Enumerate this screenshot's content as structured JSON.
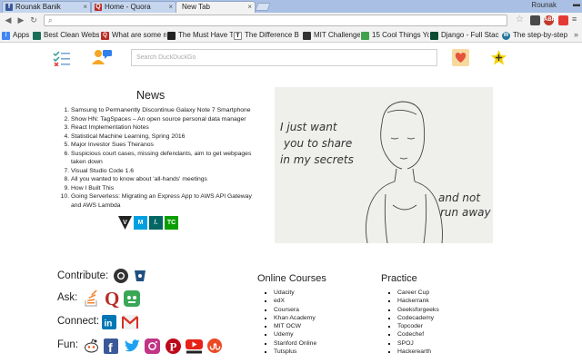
{
  "browser": {
    "tabs": [
      {
        "title": "Rounak Banik",
        "favicon": "facebook-icon"
      },
      {
        "title": "Home - Quora",
        "favicon": "quora-icon"
      },
      {
        "title": "New Tab",
        "favicon": "",
        "active": true
      }
    ],
    "profile_name": "Rounak",
    "address": "",
    "extension_badge": "ABP",
    "bookmarks": [
      {
        "label": "Apps",
        "icon": "apps-icon"
      },
      {
        "label": "Best Clean Websi",
        "icon": "bookmark-icon"
      },
      {
        "label": "What are some m",
        "icon": "quora-icon"
      },
      {
        "label": "The Must Have T",
        "icon": "bookmark-icon"
      },
      {
        "label": "The Difference B",
        "icon": "nyt-icon"
      },
      {
        "label": "MIT Challenge",
        "icon": "bookmark-icon"
      },
      {
        "label": "15 Cool Things Yo",
        "icon": "bookmark-icon"
      },
      {
        "label": "Django - Full Stac",
        "icon": "bookmark-icon"
      },
      {
        "label": "The step-by-step",
        "icon": "wordpress-icon"
      }
    ]
  },
  "header": {
    "search_placeholder": "Search DuckDuckGo"
  },
  "news": {
    "title": "News",
    "items": [
      "Samsung to Permanently Discontinue Galaxy Note 7 Smartphone",
      "Show HN: TagSpaces – An open source personal data manager",
      "React Implementation Notes",
      "Statistical Machine Learning, Spring 2016",
      "Major Investor Sues Theranos",
      "Suspicious court cases, missing defendants, aim to get webpages taken down",
      "Visual Studio Code 1.6",
      "All you wanted to know about 'all-hands' meetings",
      "How I Built This",
      "Going Serverless: Migrating an Express App to AWS API Gateway and AWS Lambda"
    ],
    "sources": [
      {
        "label": "V",
        "color": "#222222"
      },
      {
        "label": "M",
        "color": "#00a0e0"
      },
      {
        "label": "/.",
        "color": "#026664"
      },
      {
        "label": "TC",
        "color": "#0a9e01"
      }
    ]
  },
  "picture": {
    "handwriting_line1": "I just want",
    "handwriting_line2": "you to share",
    "handwriting_line3": "in my secrets",
    "handwriting_line4": "and not",
    "handwriting_line5": "run away"
  },
  "links": {
    "contribute_label": "Contribute:",
    "ask_label": "Ask:",
    "connect_label": "Connect:",
    "fun_label": "Fun:"
  },
  "courses": {
    "title": "Online Courses",
    "items": [
      "Udacity",
      "edX",
      "Coursera",
      "Khan Academy",
      "MIT OCW",
      "Udemy",
      "Stanford Online",
      "Tutsplus"
    ]
  },
  "practice": {
    "title": "Practice",
    "items": [
      "Career Cup",
      "Hackerrank",
      "Geeksforgeeks",
      "Codecademy",
      "Topcoder",
      "Codechef",
      "SPOJ",
      "Hackerearth"
    ]
  },
  "colors": {
    "tabstrip": "#a9c0e4",
    "toolbar": "#f2f2f2",
    "heart": "#f08a2a",
    "star_badge": "#f5d000",
    "quora": "#b92b27",
    "youtube": "#e62117",
    "twitter": "#1da1f2",
    "facebook": "#3b5998",
    "linkedin": "#0077b5"
  }
}
